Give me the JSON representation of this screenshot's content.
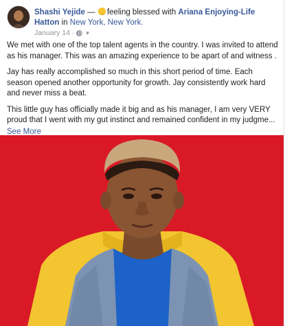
{
  "post": {
    "author": "Shashi Yejide",
    "dash": "—",
    "feeling_prefix": "feeling blessed with",
    "tagged": "Ariana Enjoying-Life Hatton",
    "in_word": "in",
    "location": "New York, New York.",
    "date": "January 14",
    "separator": "·",
    "paragraphs": [
      "We met with one of the top talent agents in the country. I was invited to attend as his manager. This was an amazing experience to be apart of and witness .",
      "Jay has really accomplished so much in this short period of time. Each season opened another opportunity for growth. Jay consistently work hard and never miss a beat.",
      "This little guy has officially made it big and as his manager, I am very VERY proud that I went with my gut instinct and remained confident in my judgme..."
    ],
    "see_more": "See More",
    "icons": {
      "feeling": "smiling-face-icon",
      "privacy": "globe-icon",
      "audience_menu": "chevron-down-icon",
      "options": "more-options-icon"
    },
    "colors": {
      "link": "#385898",
      "photo_background": "#e11d2a"
    }
  }
}
